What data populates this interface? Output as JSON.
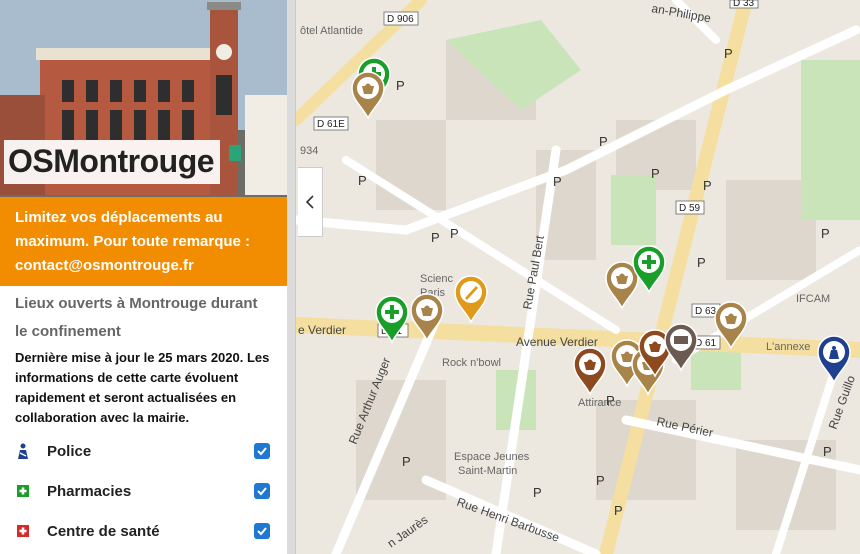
{
  "site": {
    "title": "OSMontrouge",
    "notice": "Limitez vos déplacements au maximum. Pour toute remarque : contact@osmontrouge.fr"
  },
  "info": {
    "heading": "Lieux ouverts à Montrouge durant le confinement",
    "description": "Dernière mise à jour le 25 mars 2020. Les informations de cette carte évoluent rapidement et seront actualisées en collaboration avec la mairie."
  },
  "layers": [
    {
      "label": "Police",
      "icon": "police-icon",
      "checked": true,
      "color": "#1f3f8f"
    },
    {
      "label": "Pharmacies",
      "icon": "pharmacy-cross-icon",
      "checked": true,
      "color": "#1a9e2a"
    },
    {
      "label": "Centre de santé",
      "icon": "health-cross-icon",
      "checked": true,
      "color": "#d42a2a"
    }
  ],
  "map": {
    "labels": {
      "hotel": "ôtel Atlantide",
      "sciences": "Scienc",
      "paris": "Paris",
      "rocknbowl": "Rock n'bowl",
      "attirance": "Attirance",
      "espace1": "Espace Jeunes",
      "espace2": "Saint-Martin",
      "ifcam": "IFCAM",
      "annexe": "L'annexe",
      "num934": "934"
    },
    "streets": {
      "verdier": "Avenue Verdier",
      "verdier_left": "e Verdier",
      "paulbert": "Rue Paul Bert",
      "arthur": "Rue Arthur Auger",
      "barbusse": "Rue Henri Barbusse",
      "perier": "Rue Périer",
      "jaures": "n Jaurès",
      "philippe": "an-Philippe",
      "guillo": "Rue Guillo"
    },
    "road_numbers": {
      "d906": "D 906",
      "d61e": "D 61E",
      "d59": "D 59",
      "d61": "D 61",
      "d61b": "D 61",
      "d63": "D 63",
      "d33": "D 33"
    },
    "parking": "P",
    "colors": {
      "food": "#a8844a",
      "pharmacy": "#1a9e2a",
      "bakery": "#e09a1a",
      "shop": "#8c4a1e",
      "bank": "#6b5a52",
      "police": "#1f3f8f"
    }
  }
}
